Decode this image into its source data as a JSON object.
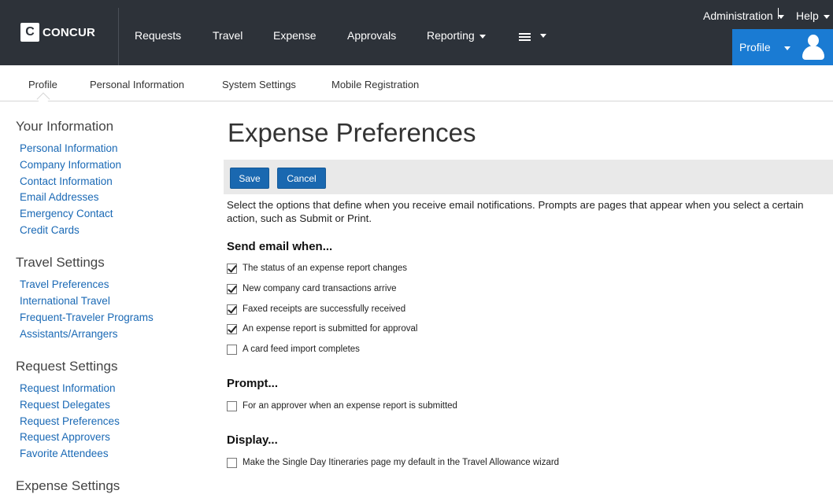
{
  "brand": {
    "logo_letter": "C",
    "name": "CONCUR"
  },
  "nav": {
    "items": [
      "Requests",
      "Travel",
      "Expense",
      "Approvals",
      "Reporting"
    ],
    "reporting_has_caret": true
  },
  "utility": {
    "administration": "Administration",
    "help": "Help"
  },
  "profile_button": {
    "label": "Profile"
  },
  "subnav": {
    "items": [
      "Profile",
      "Personal Information",
      "System Settings",
      "Mobile Registration"
    ],
    "active": "Profile"
  },
  "sidebar": {
    "sections": [
      {
        "heading": "Your Information",
        "links": [
          "Personal Information",
          "Company Information",
          "Contact Information",
          "Email Addresses",
          "Emergency Contact",
          "Credit Cards"
        ]
      },
      {
        "heading": "Travel Settings",
        "links": [
          "Travel Preferences",
          "International Travel",
          "Frequent-Traveler Programs",
          "Assistants/Arrangers"
        ]
      },
      {
        "heading": "Request Settings",
        "links": [
          "Request Information",
          "Request Delegates",
          "Request Preferences",
          "Request Approvers",
          "Favorite Attendees"
        ]
      },
      {
        "heading": "Expense Settings",
        "links": []
      }
    ]
  },
  "main": {
    "title": "Expense Preferences",
    "save_label": "Save",
    "cancel_label": "Cancel",
    "intro": "Select the options that define when you receive email notifications. Prompts are pages that appear when you select a certain action, such as Submit or Print.",
    "email_section": {
      "heading": "Send email when...",
      "options": [
        {
          "label": "The status of an expense report changes",
          "checked": true
        },
        {
          "label": "New company card transactions arrive",
          "checked": true
        },
        {
          "label": "Faxed receipts are successfully received",
          "checked": true
        },
        {
          "label": "An expense report is submitted for approval",
          "checked": true
        },
        {
          "label": "A card feed import completes",
          "checked": false
        }
      ]
    },
    "prompt_section": {
      "heading": "Prompt...",
      "options": [
        {
          "label": "For an approver when an expense report is submitted",
          "checked": false
        }
      ]
    },
    "display_section": {
      "heading": "Display...",
      "options": [
        {
          "label": "Make the Single Day Itineraries page my default in the Travel Allowance wizard",
          "checked": false
        }
      ]
    }
  },
  "colors": {
    "topbar": "#2d3239",
    "accent": "#1a7bd3",
    "link": "#1a69b5",
    "button": "#1a68b0"
  }
}
